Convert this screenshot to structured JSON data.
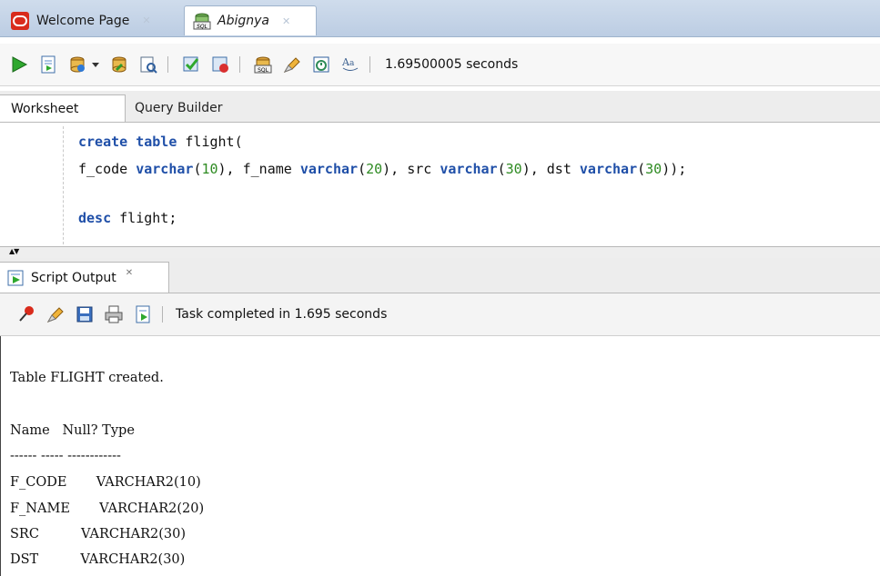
{
  "doc_tabs": [
    {
      "label": "Welcome Page",
      "icon": "oracle-icon",
      "active": false
    },
    {
      "label": "Abignya",
      "icon": "sql-worksheet-icon",
      "active": true
    }
  ],
  "toolbar": {
    "run_time": "1.69500005 seconds",
    "icons": [
      "run-statement-icon",
      "run-script-icon",
      "commit-icon",
      "dropdown-icon",
      "rollback-icon",
      "explain-plan-icon",
      "autotrace-icon",
      "sql-tuning-icon",
      "unshared-sql-icon",
      "clear-icon",
      "history-icon",
      "format-icon"
    ]
  },
  "worksheet_tabs": [
    {
      "label": "Worksheet",
      "active": true
    },
    {
      "label": "Query Builder",
      "active": false
    }
  ],
  "editor": {
    "lines": [
      "create table flight(",
      "f_code varchar(10), f_name varchar(20), src varchar(30), dst varchar(30));",
      "",
      "desc flight;"
    ]
  },
  "output_panel": {
    "tab_label": "Script Output",
    "status": "Task completed in 1.695 seconds",
    "lines": [
      "Table FLIGHT created.",
      "Name   Null? Type",
      "------ ----- ------------",
      "F_CODE       VARCHAR2(10)",
      "F_NAME       VARCHAR2(20)",
      "SRC          VARCHAR2(30)",
      "DST          VARCHAR2(30)"
    ]
  },
  "colors": {
    "keyword": "#1f4fa8",
    "number": "#2e8b22",
    "oracle_red": "#d92b1c",
    "tab_bar": "#c5d4e8"
  }
}
